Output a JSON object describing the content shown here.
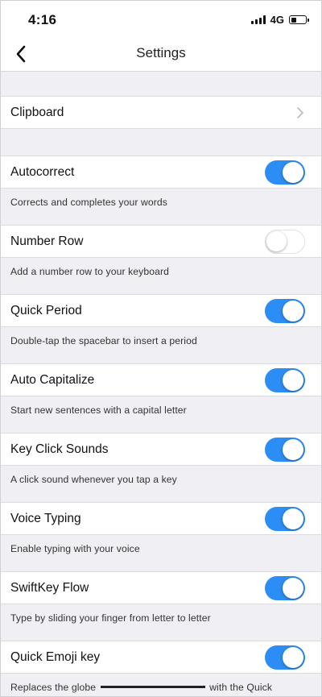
{
  "status_bar": {
    "time": "4:16",
    "network": "4G",
    "icons": [
      "signal-icon",
      "battery-icon"
    ]
  },
  "nav": {
    "back_icon": "chevron-left-icon",
    "title": "Settings"
  },
  "clipboard": {
    "label": "Clipboard",
    "icon": "chevron-right-icon"
  },
  "settings": [
    {
      "label": "Autocorrect",
      "description": "Corrects and completes your words",
      "enabled": true
    },
    {
      "label": "Number Row",
      "description": "Add a number row to your keyboard",
      "enabled": false
    },
    {
      "label": "Quick Period",
      "description": "Double-tap the spacebar to insert a period",
      "enabled": true
    },
    {
      "label": "Auto Capitalize",
      "description": "Start new sentences with a capital letter",
      "enabled": true
    },
    {
      "label": "Key Click Sounds",
      "description": "A click sound whenever you tap a key",
      "enabled": true
    },
    {
      "label": "Voice Typing",
      "description": "Enable typing with your voice",
      "enabled": true
    },
    {
      "label": "SwiftKey Flow",
      "description": "Type by sliding your finger from letter to letter",
      "enabled": true
    },
    {
      "label": "Quick Emoji key",
      "description_start": "Replaces the globe ",
      "description_end": " with the Quick",
      "enabled": true
    }
  ],
  "colors": {
    "toggle_on": "#2c8df5",
    "background": "#efeff4"
  }
}
